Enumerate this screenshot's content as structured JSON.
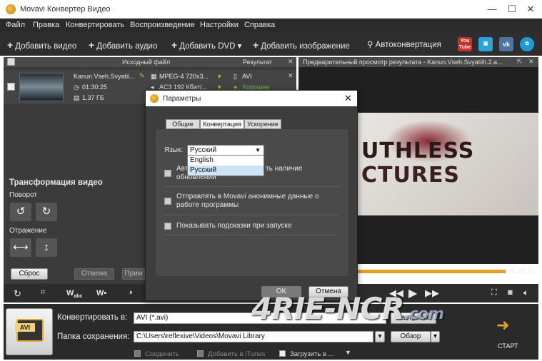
{
  "window": {
    "title": "Movavi Конвертер Видео",
    "controls": [
      "—",
      "☐",
      "✕"
    ]
  },
  "menu": [
    "Файл",
    "Правка",
    "Конвертировать",
    "Воспроизведение",
    "Настройки",
    "Справка"
  ],
  "toolbar": {
    "add_video": "Добавить видео",
    "add_audio": "Добавить аудио",
    "add_dvd": "Добавить DVD ▾",
    "add_image": "Добавить изображение",
    "autoconvert": "Автоконвертация",
    "youtube_text": "You\nTube"
  },
  "filelist": {
    "col_source": "Исходный файл",
    "col_result": "Результат",
    "file": {
      "name": "Kanun.Vseh.Svyatii...",
      "duration": "01:30:25",
      "size": "1.37 ГБ",
      "video": "MPEG-4 720x3...",
      "audio": "AC3 192 Кбит/...",
      "result_format": "AVI",
      "result_quality": "Хорошее"
    }
  },
  "preview": {
    "header": "Предварительный просмотр результата - Kanun.Vseh.Svyatiih.2.a...",
    "image_text_1": "UTHLESS",
    "image_text_2": "CTURES",
    "time_end": "1:30:25"
  },
  "transform": {
    "title": "Трансформация видео",
    "rotate": "Поворот",
    "mirror": "Отражение",
    "reset": "Сброс",
    "cancel": "Отмена",
    "apply_partial": "Прим"
  },
  "bottom": {
    "format_icon_label": "AVI",
    "convert_to_label": "Конвертировать в:",
    "convert_to_value": "AVI (*.avi)",
    "settings_button": "Настройки",
    "save_folder_label": "Папка сохранения:",
    "save_folder_value": "C:\\Users\\reflexive\\Videos\\Movavi Library",
    "browse_button": "Обзор",
    "start": "СТАРТ",
    "join": "Соединить",
    "add_itunes": "Добавить в iTunes",
    "upload": "Загрузить в ..."
  },
  "dialog": {
    "title": "Параметры",
    "tabs": [
      "Общие",
      "Конвертация",
      "Ускорение"
    ],
    "language_label": "Язык:",
    "language_value": "Русский",
    "language_options": [
      "English",
      "Русский"
    ],
    "option_updates": "Автоматически проверять наличие обновлений",
    "option_updates_visible_a": "Авт",
    "option_updates_visible_b": "ть наличие",
    "option_updates_visible_c": "обновлений",
    "option_anon": "Отправлять в Movavi анонимные данные о работе программы",
    "option_hints": "Показывать подсказки при запуске",
    "ok": "OK",
    "cancel": "Отмена"
  },
  "watermark": {
    "main": "4RIE-NCR",
    "suffix": ".com"
  },
  "colors": {
    "accent": "#e79c1e",
    "dark_bg": "#2b2b2b",
    "quality_green": "#6fbf3a",
    "select_highlight": "#cfe3f7"
  }
}
